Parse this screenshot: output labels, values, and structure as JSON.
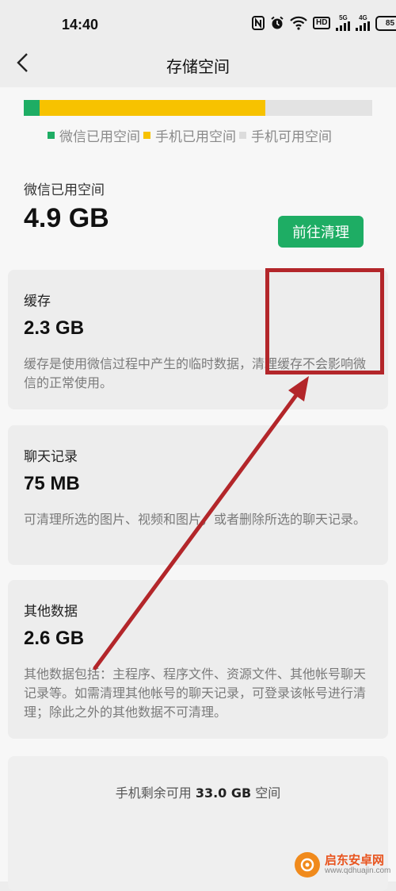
{
  "status_bar": {
    "time": "14:40",
    "hd_label": "HD",
    "signal1_label": "5G",
    "signal2_label": "4G",
    "battery_level": "85"
  },
  "nav": {
    "title": "存储空间",
    "back_icon": "chevron-left-icon"
  },
  "storage_bar": {
    "segments": [
      {
        "name": "微信已用空间",
        "fraction": 0.046,
        "color": "#1ead64"
      },
      {
        "name": "手机已用空间",
        "fraction": 0.648,
        "color": "#f7c200"
      },
      {
        "name": "手机可用空间",
        "fraction": 0.306,
        "color": "#e3e3e3"
      }
    ],
    "legend": [
      "微信已用空间",
      "手机已用空间",
      "手机可用空间"
    ]
  },
  "total": {
    "label": "微信已用空间",
    "value": "4.9 GB"
  },
  "cache": {
    "label": "缓存",
    "value": "2.3 GB",
    "button": "前往清理",
    "desc": "缓存是使用微信过程中产生的临时数据，清理缓存不会影响微信的正常使用。"
  },
  "chat": {
    "label": "聊天记录",
    "value": "75 MB",
    "desc": "可清理所选的图片、视频和图片，或者删除所选的聊天记录。"
  },
  "other": {
    "label": "其他数据",
    "value": "2.6 GB",
    "desc": "其他数据包括：主程序、程序文件、资源文件、其他帐号聊天记录等。如需清理其他帐号的聊天记录，可登录该帐号进行清理；除此之外的其他数据不可清理。"
  },
  "free": {
    "prefix": "手机剩余可用",
    "amount": "33.0 GB",
    "suffix": "空间"
  },
  "annotation_color": "#b3262a",
  "watermark": {
    "name": "启东安卓网",
    "url": "www.qdhuajin.com"
  }
}
